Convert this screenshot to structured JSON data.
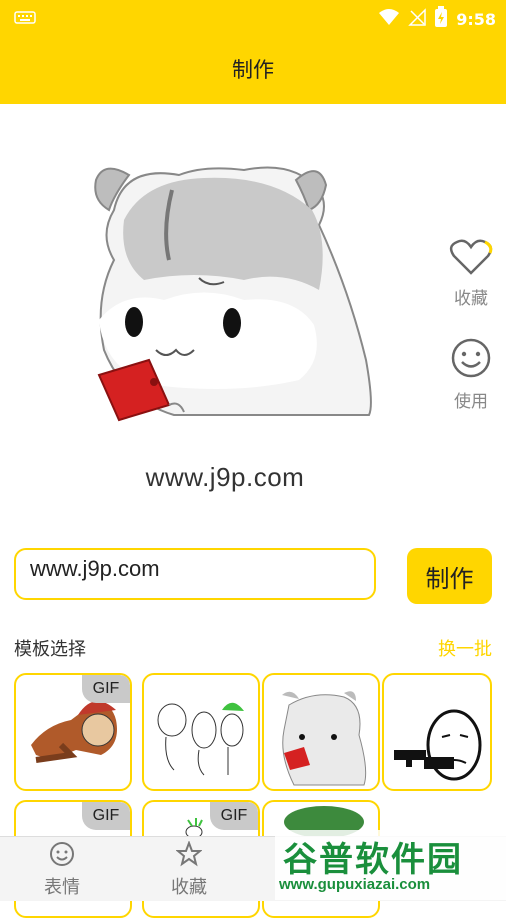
{
  "status_bar": {
    "time": "9:58"
  },
  "header": {
    "title": "制作"
  },
  "preview": {
    "caption": "www.j9p.com"
  },
  "side_actions": {
    "favorite_label": "收藏",
    "use_label": "使用"
  },
  "input": {
    "value": "www.j9p.com"
  },
  "make_button": {
    "label": "制作"
  },
  "templates": {
    "title": "模板选择",
    "refresh_label": "换一批",
    "gif_badge": "GIF"
  },
  "bottom_nav": {
    "items": [
      {
        "label": "表情",
        "icon": "smile-icon"
      },
      {
        "label": "收藏",
        "icon": "star-icon"
      }
    ]
  },
  "watermark": {
    "title": "谷普软件园",
    "url": "www.gupuxiazai.com"
  },
  "colors": {
    "accent": "#ffd600",
    "watermark": "#1a8f3c"
  }
}
